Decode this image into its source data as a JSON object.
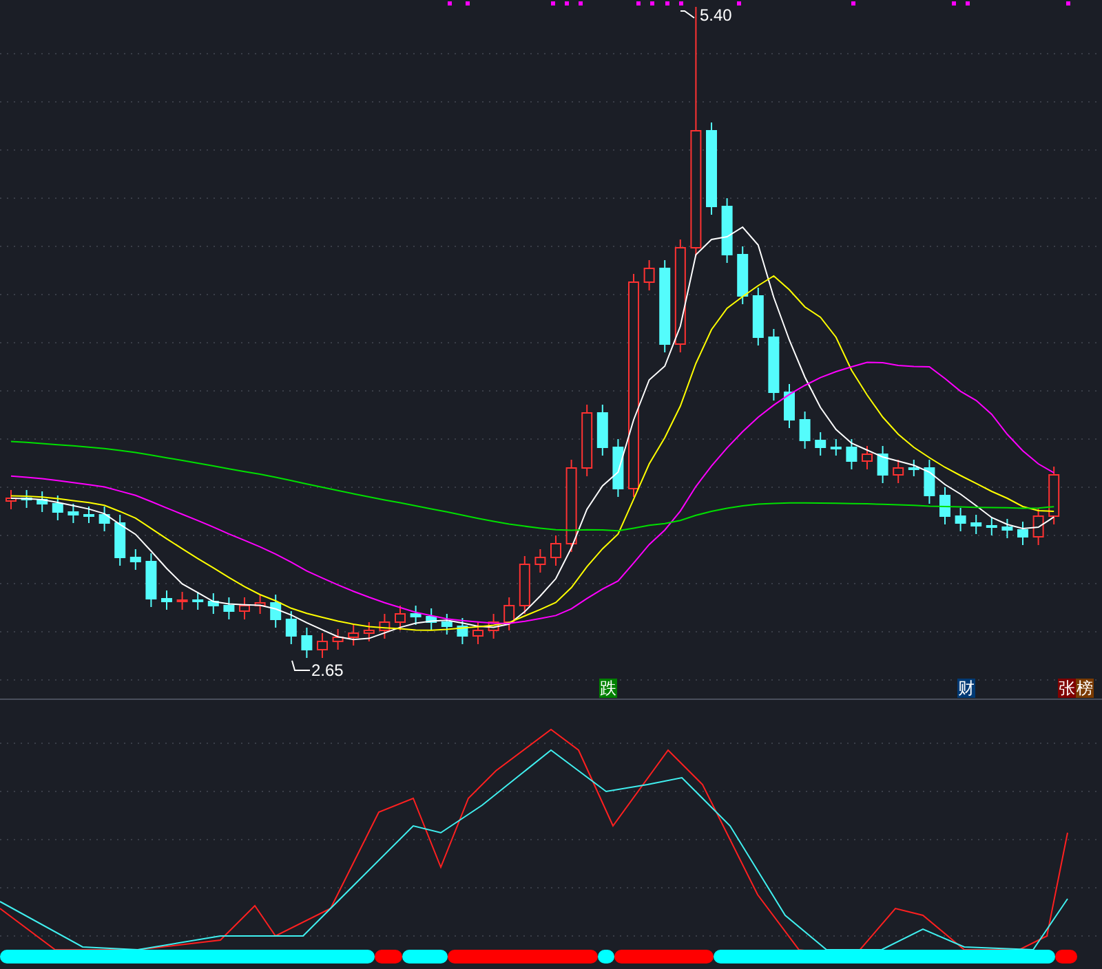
{
  "price_chart": {
    "price_labels": [
      {
        "kind": "high",
        "text": "5.40"
      },
      {
        "kind": "low",
        "text": "2.65"
      }
    ],
    "markers": [
      {
        "text": "跌",
        "color": "#008000"
      },
      {
        "text": "财",
        "color": "#003a75"
      },
      {
        "text": "张",
        "color": "#800000"
      },
      {
        "text": "榜",
        "color": "#7a3a00"
      }
    ]
  }
}
